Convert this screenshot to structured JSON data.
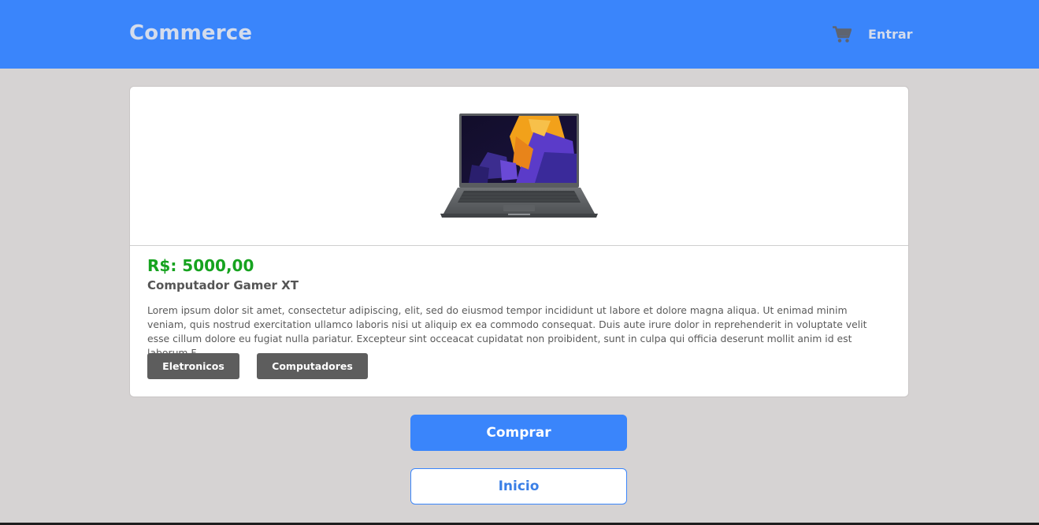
{
  "navbar": {
    "brand": "Commerce",
    "cart_icon": "shopping-cart-icon",
    "login_label": "Entrar",
    "background_color": "#3a85fb"
  },
  "product": {
    "image_icon": "laptop-image",
    "price": "R$: 5000,00",
    "price_color": "#16a31f",
    "name": "Computador Gamer XT",
    "description": "Lorem ipsum dolor sit amet, consectetur adipiscing, elit, sed do eiusmod tempor incididunt ut labore et dolore magna aliqua. Ut enimad minim veniam, quis nostrud exercitation ullamco laboris nisi ut aliquip ex ea commodo consequat. Duis aute irure dolor in reprehenderit in voluptate velit esse cillum dolore eu fugiat nulla pariatur. Excepteur sint occeacat cupidatat non proibident, sunt in culpa qui officia deserunt mollit anim id est laborum.F",
    "categories": [
      "Eletronicos",
      "Computadores"
    ]
  },
  "actions": {
    "buy_label": "Comprar",
    "home_label": "Inicio"
  }
}
